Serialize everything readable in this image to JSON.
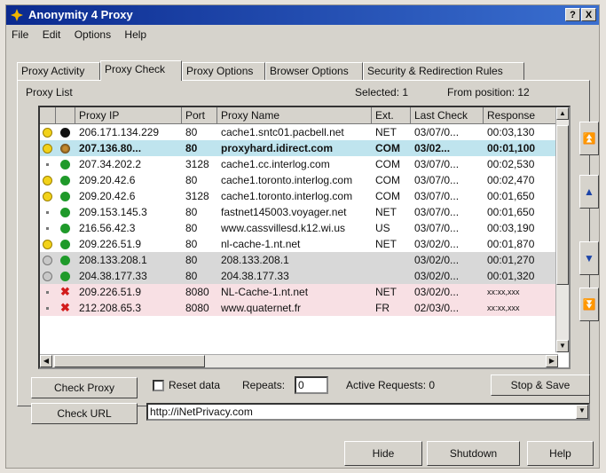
{
  "window": {
    "title": "Anonymity 4 Proxy"
  },
  "titlebar_buttons": [
    "?",
    "X"
  ],
  "menu": [
    "File",
    "Edit",
    "Options",
    "Help"
  ],
  "tabs": [
    {
      "label": "Proxy Activity"
    },
    {
      "label": "Proxy Check",
      "active": true
    },
    {
      "label": "Proxy Options"
    },
    {
      "label": "Browser Options"
    },
    {
      "label": "Security & Redirection Rules"
    }
  ],
  "proxy_list": {
    "label": "Proxy List",
    "selected": "Selected: 1",
    "from_position": "From position: 12",
    "columns": [
      "",
      "",
      "Proxy IP",
      "Port",
      "Proxy Name",
      "Ext.",
      "Last Check",
      "Response"
    ],
    "rows": [
      {
        "status": "smiley",
        "light": "black",
        "ip": "206.171.134.229",
        "port": "80",
        "name": "cache1.sntc01.pacbell.net",
        "ext": "NET",
        "last": "03/07/0...",
        "resp": "00:03,130",
        "bg": "#ffffff"
      },
      {
        "status": "smiley",
        "light": "spin",
        "ip": "207.136.80...",
        "port": "80",
        "name": "proxyhard.idirect.com",
        "ext": "COM",
        "last": "03/02...",
        "resp": "00:01,100",
        "bg": "#bfe4ee",
        "bold": true
      },
      {
        "status": "dot",
        "light": "green",
        "ip": "207.34.202.2",
        "port": "3128",
        "name": "cache1.cc.interlog.com",
        "ext": "COM",
        "last": "03/07/0...",
        "resp": "00:02,530",
        "bg": "#ffffff"
      },
      {
        "status": "smiley",
        "light": "green",
        "ip": "209.20.42.6",
        "port": "80",
        "name": "cache1.toronto.interlog.com",
        "ext": "COM",
        "last": "03/07/0...",
        "resp": "00:02,470",
        "bg": "#ffffff"
      },
      {
        "status": "smiley",
        "light": "green",
        "ip": "209.20.42.6",
        "port": "3128",
        "name": "cache1.toronto.interlog.com",
        "ext": "COM",
        "last": "03/07/0...",
        "resp": "00:01,650",
        "bg": "#ffffff"
      },
      {
        "status": "dot",
        "light": "green",
        "ip": "209.153.145.3",
        "port": "80",
        "name": "fastnet145003.voyager.net",
        "ext": "NET",
        "last": "03/07/0...",
        "resp": "00:01,650",
        "bg": "#ffffff"
      },
      {
        "status": "dot",
        "light": "green",
        "ip": "216.56.42.3",
        "port": "80",
        "name": "www.cassvillesd.k12.wi.us",
        "ext": "US",
        "last": "03/07/0...",
        "resp": "00:03,190",
        "bg": "#ffffff"
      },
      {
        "status": "smiley",
        "light": "green",
        "ip": "209.226.51.9",
        "port": "80",
        "name": "nl-cache-1.nt.net",
        "ext": "NET",
        "last": "03/02/0...",
        "resp": "00:01,870",
        "bg": "#ffffff"
      },
      {
        "status": "grey",
        "light": "green",
        "ip": "208.133.208.1",
        "port": "80",
        "name": "208.133.208.1",
        "ext": "",
        "last": "03/02/0...",
        "resp": "00:01,270",
        "bg": "#d8d8d8"
      },
      {
        "status": "grey",
        "light": "green",
        "ip": "204.38.177.33",
        "port": "80",
        "name": "204.38.177.33",
        "ext": "",
        "last": "03/02/0...",
        "resp": "00:01,320",
        "bg": "#d8d8d8"
      },
      {
        "status": "dot",
        "light": "x",
        "ip": "209.226.51.9",
        "port": "8080",
        "name": "NL-Cache-1.nt.net",
        "ext": "NET",
        "last": "03/02/0...",
        "resp": "xx:xx,xxx",
        "bg": "#f8e0e4"
      },
      {
        "status": "dot",
        "light": "x",
        "ip": "212.208.65.3",
        "port": "8080",
        "name": "www.quaternet.fr",
        "ext": "FR",
        "last": "02/03/0...",
        "resp": "xx:xx,xxx",
        "bg": "#f8e0e4"
      }
    ]
  },
  "controls": {
    "check_proxy": "Check Proxy",
    "reset_data": "Reset data",
    "repeats_label": "Repeats:",
    "repeats_value": "0",
    "active_requests": "Active Requests: 0",
    "stop_save": "Stop & Save",
    "check_url": "Check URL",
    "url_value": "http://iNetPrivacy.com"
  },
  "footer": {
    "hide": "Hide",
    "shutdown": "Shutdown",
    "help": "Help"
  },
  "colors": {
    "title_start": "#0b2a8f",
    "selected_row": "#bfe4ee",
    "failed_row": "#f8e0e4",
    "ok_light": "#1f9a2a"
  }
}
